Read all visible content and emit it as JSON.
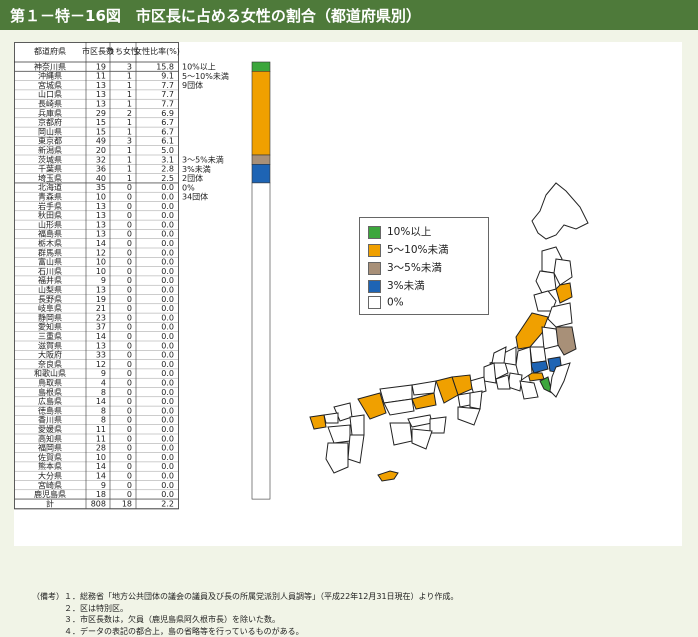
{
  "title": "第１－特－16図　市区長に占める女性の割合（都道府県別）",
  "chart_data": {
    "type": "table",
    "columns": [
      "都道府県",
      "市区長数",
      "うち女性",
      "女性比率(%)"
    ],
    "rows": [
      [
        "神奈川県",
        "19",
        "3",
        "15.8"
      ],
      [
        "沖縄県",
        "11",
        "1",
        "9.1"
      ],
      [
        "宮城県",
        "13",
        "1",
        "7.7"
      ],
      [
        "山口県",
        "13",
        "1",
        "7.7"
      ],
      [
        "長崎県",
        "13",
        "1",
        "7.7"
      ],
      [
        "兵庫県",
        "29",
        "2",
        "6.9"
      ],
      [
        "京都府",
        "15",
        "1",
        "6.7"
      ],
      [
        "岡山県",
        "15",
        "1",
        "6.7"
      ],
      [
        "東京都",
        "49",
        "3",
        "6.1"
      ],
      [
        "新潟県",
        "20",
        "1",
        "5.0"
      ],
      [
        "茨城県",
        "32",
        "1",
        "3.1"
      ],
      [
        "千葉県",
        "36",
        "1",
        "2.8"
      ],
      [
        "埼玉県",
        "40",
        "1",
        "2.5"
      ],
      [
        "北海道",
        "35",
        "0",
        "0.0"
      ],
      [
        "青森県",
        "10",
        "0",
        "0.0"
      ],
      [
        "岩手県",
        "13",
        "0",
        "0.0"
      ],
      [
        "秋田県",
        "13",
        "0",
        "0.0"
      ],
      [
        "山形県",
        "13",
        "0",
        "0.0"
      ],
      [
        "福島県",
        "13",
        "0",
        "0.0"
      ],
      [
        "栃木県",
        "14",
        "0",
        "0.0"
      ],
      [
        "群馬県",
        "12",
        "0",
        "0.0"
      ],
      [
        "富山県",
        "10",
        "0",
        "0.0"
      ],
      [
        "石川県",
        "10",
        "0",
        "0.0"
      ],
      [
        "福井県",
        "9",
        "0",
        "0.0"
      ],
      [
        "山梨県",
        "13",
        "0",
        "0.0"
      ],
      [
        "長野県",
        "19",
        "0",
        "0.0"
      ],
      [
        "岐阜県",
        "21",
        "0",
        "0.0"
      ],
      [
        "静岡県",
        "23",
        "0",
        "0.0"
      ],
      [
        "愛知県",
        "37",
        "0",
        "0.0"
      ],
      [
        "三重県",
        "14",
        "0",
        "0.0"
      ],
      [
        "滋賀県",
        "13",
        "0",
        "0.0"
      ],
      [
        "大阪府",
        "33",
        "0",
        "0.0"
      ],
      [
        "奈良県",
        "12",
        "0",
        "0.0"
      ],
      [
        "和歌山県",
        "9",
        "0",
        "0.0"
      ],
      [
        "鳥取県",
        "4",
        "0",
        "0.0"
      ],
      [
        "島根県",
        "8",
        "0",
        "0.0"
      ],
      [
        "広島県",
        "14",
        "0",
        "0.0"
      ],
      [
        "徳島県",
        "8",
        "0",
        "0.0"
      ],
      [
        "香川県",
        "8",
        "0",
        "0.0"
      ],
      [
        "愛媛県",
        "11",
        "0",
        "0.0"
      ],
      [
        "高知県",
        "11",
        "0",
        "0.0"
      ],
      [
        "福岡県",
        "28",
        "0",
        "0.0"
      ],
      [
        "佐賀県",
        "10",
        "0",
        "0.0"
      ],
      [
        "熊本県",
        "14",
        "0",
        "0.0"
      ],
      [
        "大分県",
        "14",
        "0",
        "0.0"
      ],
      [
        "宮崎県",
        "9",
        "0",
        "0.0"
      ],
      [
        "鹿児島県",
        "18",
        "0",
        "0.0"
      ],
      [
        "計",
        "808",
        "18",
        "2.2"
      ]
    ],
    "groups": [
      {
        "label": "10%以上",
        "count": "",
        "color": "#3ca63c",
        "first": 0,
        "last": 0
      },
      {
        "label": "5～10%未満",
        "count": "9団体",
        "color": "#f0a000",
        "first": 1,
        "last": 9
      },
      {
        "label": "3～5%未満",
        "count": "",
        "color": "#a89078",
        "first": 10,
        "last": 10
      },
      {
        "label": "3%未満",
        "count": "2団体",
        "color": "#1e64b4",
        "first": 11,
        "last": 12
      },
      {
        "label": "0%",
        "count": "34団体",
        "color": "#ffffff",
        "first": 13,
        "last": 46
      }
    ],
    "legend": [
      {
        "label": "10%以上",
        "color": "#3ca63c"
      },
      {
        "label": "5～10%未満",
        "color": "#f0a000"
      },
      {
        "label": "3～5%未満",
        "color": "#a89078"
      },
      {
        "label": "3%未満",
        "color": "#1e64b4"
      },
      {
        "label": "0%",
        "color": "#ffffff"
      }
    ]
  },
  "notes": [
    {
      "label": "（備考）",
      "text": "１．総務省「地方公共団体の議会の議員及び長の所属党派別人員調等」（平成22年12月31日現在）より作成。"
    },
    {
      "label": "",
      "text": "２．区は特別区。"
    },
    {
      "label": "",
      "text": "３．市区長数は，欠員（鹿児島県阿久根市長）を除いた数。"
    },
    {
      "label": "",
      "text": "４．データの表記の都合上，島の省略等を行っているものがある。"
    }
  ]
}
